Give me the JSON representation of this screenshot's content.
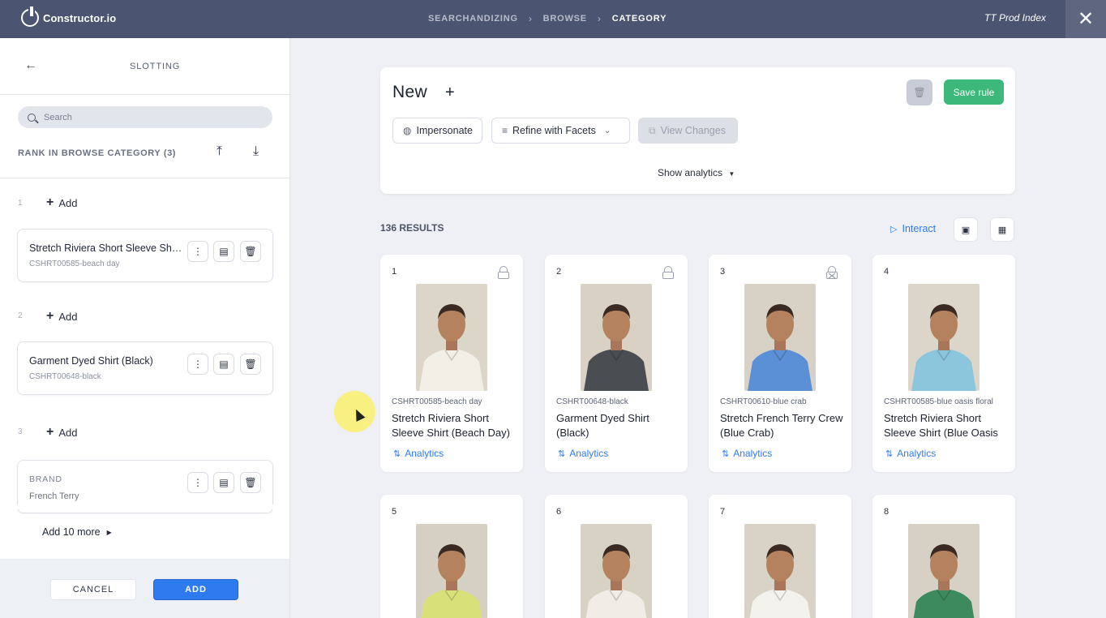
{
  "app": {
    "logo_text": "Constructor.io",
    "breadcrumbs": [
      "SEARCHANDIZING",
      "BROWSE",
      "CATEGORY"
    ],
    "index_name": "TT Prod Index",
    "close_glyph": "✕"
  },
  "sidebar": {
    "title": "SLOTTING",
    "search_placeholder": "Search",
    "rank_title": "RANK IN BROWSE CATEGORY (3)",
    "add_label": "Add",
    "slots": [
      {
        "number": "1",
        "name": "Stretch Riviera Short Sleeve Shirt (Beach Day)",
        "sku": "CSHRT00585-beach day"
      },
      {
        "number": "2",
        "name": "Garment Dyed Shirt (Black)",
        "sku": "CSHRT00648-black"
      },
      {
        "number": "3",
        "label": "BRAND",
        "value": "French Terry"
      }
    ],
    "add_more": "Add 10 more",
    "cancel_label": "CANCEL",
    "add_button_label": "ADD"
  },
  "rule": {
    "title": "New",
    "save_label": "Save rule",
    "impersonate_label": "Impersonate",
    "refine_label": "Refine with Facets",
    "view_changes_label": "View Changes",
    "show_analytics_label": "Show analytics"
  },
  "results": {
    "count_label": "136 RESULTS",
    "interact_label": "Interact",
    "analytics_label": "Analytics",
    "products": [
      {
        "rank": "1",
        "sku": "CSHRT00585-beach day",
        "name": "Stretch Riviera Short Sleeve Shirt (Beach Day)",
        "lock": "locked",
        "shirt_color": "#f2efe6",
        "bg_color": "#dcd6c9"
      },
      {
        "rank": "2",
        "sku": "CSHRT00648-black",
        "name": "Garment Dyed Shirt (Black)",
        "lock": "locked",
        "shirt_color": "#4a4d52",
        "bg_color": "#d9d2c4"
      },
      {
        "rank": "3",
        "sku": "CSHRT00610-blue crab",
        "name": "Stretch French Terry Crew (Blue Crab)",
        "lock": "locked-crossed",
        "shirt_color": "#5b8fd6",
        "bg_color": "#d8d2c6"
      },
      {
        "rank": "4",
        "sku": "CSHRT00585-blue oasis floral",
        "name": "Stretch Riviera Short Sleeve Shirt (Blue Oasis Floral)",
        "lock": "none",
        "shirt_color": "#8cc6dc",
        "bg_color": "#dcd6ca"
      },
      {
        "rank": "5",
        "shirt_color": "#d8e07a",
        "bg_color": "#d6d0c4"
      },
      {
        "rank": "6",
        "shirt_color": "#f1ece6",
        "bg_color": "#d8d2c5"
      },
      {
        "rank": "7",
        "shirt_color": "#f4f2ec",
        "bg_color": "#d9d3c7"
      },
      {
        "rank": "8",
        "shirt_color": "#3c8a5e",
        "bg_color": "#d7d1c5"
      }
    ]
  },
  "colors": {
    "topbar": "#4b5470",
    "accent_blue": "#2e7bf0",
    "save_green": "#3bb87a"
  }
}
